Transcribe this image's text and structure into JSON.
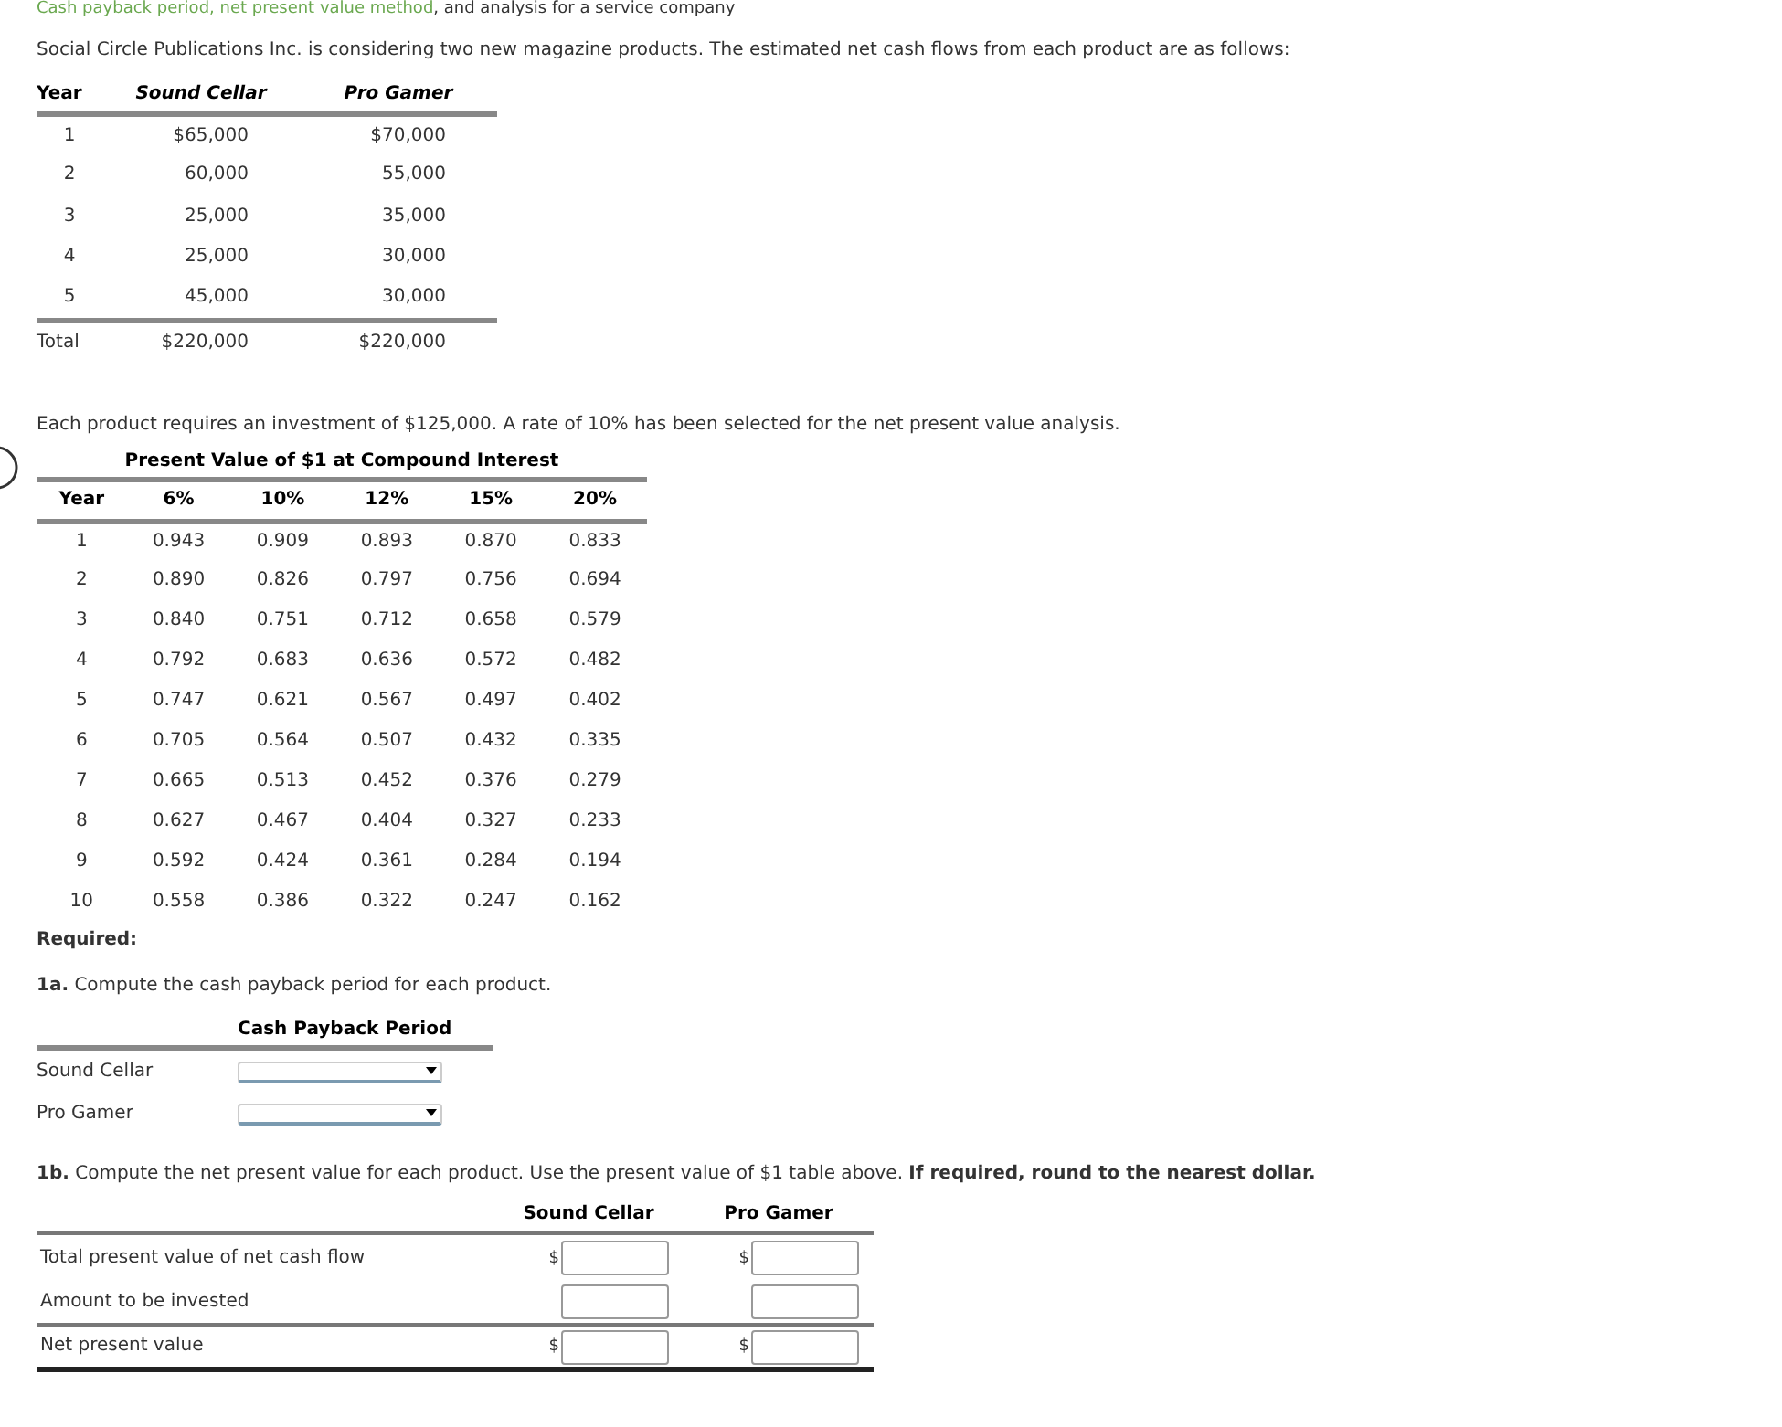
{
  "title": {
    "link": "Cash payback period, net present value method",
    "rest": ", and analysis for a service company"
  },
  "intro": "Social Circle Publications Inc. is considering two new magazine products. The estimated net cash flows from each product are as follows:",
  "cash_flows": {
    "columns": [
      "Year",
      "Sound Cellar",
      "Pro Gamer"
    ],
    "rows": [
      [
        "1",
        "$65,000",
        "$70,000"
      ],
      [
        "2",
        "60,000",
        "55,000"
      ],
      [
        "3",
        "25,000",
        "35,000"
      ],
      [
        "4",
        "25,000",
        "30,000"
      ],
      [
        "5",
        "45,000",
        "30,000"
      ]
    ],
    "total": [
      "Total",
      "$220,000",
      "$220,000"
    ]
  },
  "investment_note": "Each product requires an investment of $125,000. A rate of 10% has been selected for the net present value analysis.",
  "pv_table": {
    "title": "Present Value of $1 at Compound Interest",
    "columns": [
      "Year",
      "6%",
      "10%",
      "12%",
      "15%",
      "20%"
    ],
    "rows": [
      [
        "1",
        "0.943",
        "0.909",
        "0.893",
        "0.870",
        "0.833"
      ],
      [
        "2",
        "0.890",
        "0.826",
        "0.797",
        "0.756",
        "0.694"
      ],
      [
        "3",
        "0.840",
        "0.751",
        "0.712",
        "0.658",
        "0.579"
      ],
      [
        "4",
        "0.792",
        "0.683",
        "0.636",
        "0.572",
        "0.482"
      ],
      [
        "5",
        "0.747",
        "0.621",
        "0.567",
        "0.497",
        "0.402"
      ],
      [
        "6",
        "0.705",
        "0.564",
        "0.507",
        "0.432",
        "0.335"
      ],
      [
        "7",
        "0.665",
        "0.513",
        "0.452",
        "0.376",
        "0.279"
      ],
      [
        "8",
        "0.627",
        "0.467",
        "0.404",
        "0.327",
        "0.233"
      ],
      [
        "9",
        "0.592",
        "0.424",
        "0.361",
        "0.284",
        "0.194"
      ],
      [
        "10",
        "0.558",
        "0.386",
        "0.322",
        "0.247",
        "0.162"
      ]
    ]
  },
  "required_label": "Required:",
  "part_1a": {
    "text": "**1a.** Compute the cash payback period for each product.",
    "column": "Cash Payback Period",
    "rows": [
      "Sound Cellar",
      "Pro Gamer"
    ]
  },
  "part_1b": {
    "text": "**1b.** Compute the net present value for each product. Use the present value of $1 table above. **If required, round to the nearest dollar.**",
    "columns": [
      "Sound Cellar",
      "Pro Gamer"
    ],
    "rows": [
      {
        "label": "Total present value of net cash flow",
        "currency": "$"
      },
      {
        "label": "Amount to be invested"
      },
      {
        "label": "Net present value",
        "currency": "$"
      }
    ]
  }
}
